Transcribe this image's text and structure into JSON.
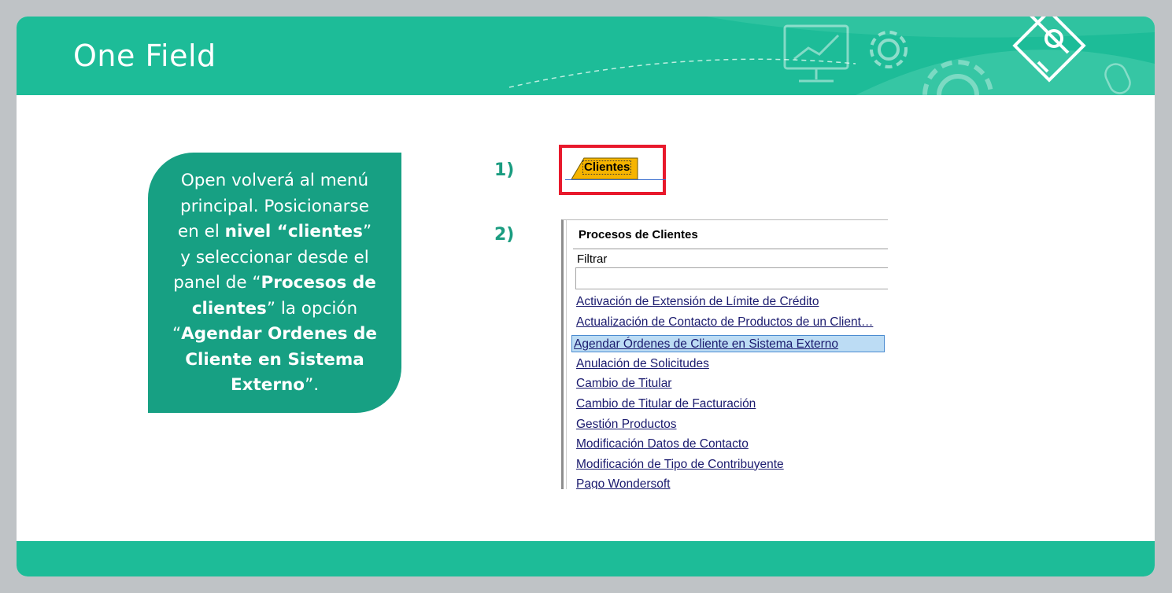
{
  "header": {
    "title": "One Field"
  },
  "callout": {
    "parts": [
      {
        "text": "Open volverá al menú principal. Posicionarse en el ",
        "bold": false
      },
      {
        "text": "nivel “clientes",
        "bold": true
      },
      {
        "text": "” y seleccionar desde el panel de “",
        "bold": false
      },
      {
        "text": "Procesos de clientes",
        "bold": true
      },
      {
        "text": "” la opción “",
        "bold": false
      },
      {
        "text": "Agendar Ordenes de Cliente en Sistema Externo",
        "bold": true
      },
      {
        "text": "”.",
        "bold": false
      }
    ]
  },
  "steps": {
    "step1": "1)",
    "step2": "2)"
  },
  "tab": {
    "label": "Clientes"
  },
  "panel": {
    "title": "Procesos de Clientes",
    "filter_label": "Filtrar",
    "filter_value": "",
    "items": [
      {
        "label": "Activación de Extensión de Límite de Crédito",
        "selected": false
      },
      {
        "label": "Actualización de Contacto de Productos de un Client…",
        "selected": false
      },
      {
        "label": "Agendar Órdenes de Cliente en Sistema Externo",
        "selected": true
      },
      {
        "label": "Anulación de Solicitudes",
        "selected": false
      },
      {
        "label": "Cambio de Titular",
        "selected": false
      },
      {
        "label": "Cambio de Titular de Facturación",
        "selected": false
      },
      {
        "label": "Gestión Productos",
        "selected": false
      },
      {
        "label": "Modificación Datos de Contacto",
        "selected": false
      },
      {
        "label": "Modificación de Tipo de Contribuyente",
        "selected": false
      },
      {
        "label": "Pago Wondersoft",
        "selected": false
      }
    ]
  },
  "colors": {
    "brand": "#1dbc98",
    "callout": "#17a083",
    "highlight": "#e8192c",
    "tab": "#f6b400"
  },
  "icons": [
    "monitor-chart-icon",
    "gear-icon",
    "gear-large-icon",
    "edit-diamond-icon",
    "mouse-icon"
  ]
}
